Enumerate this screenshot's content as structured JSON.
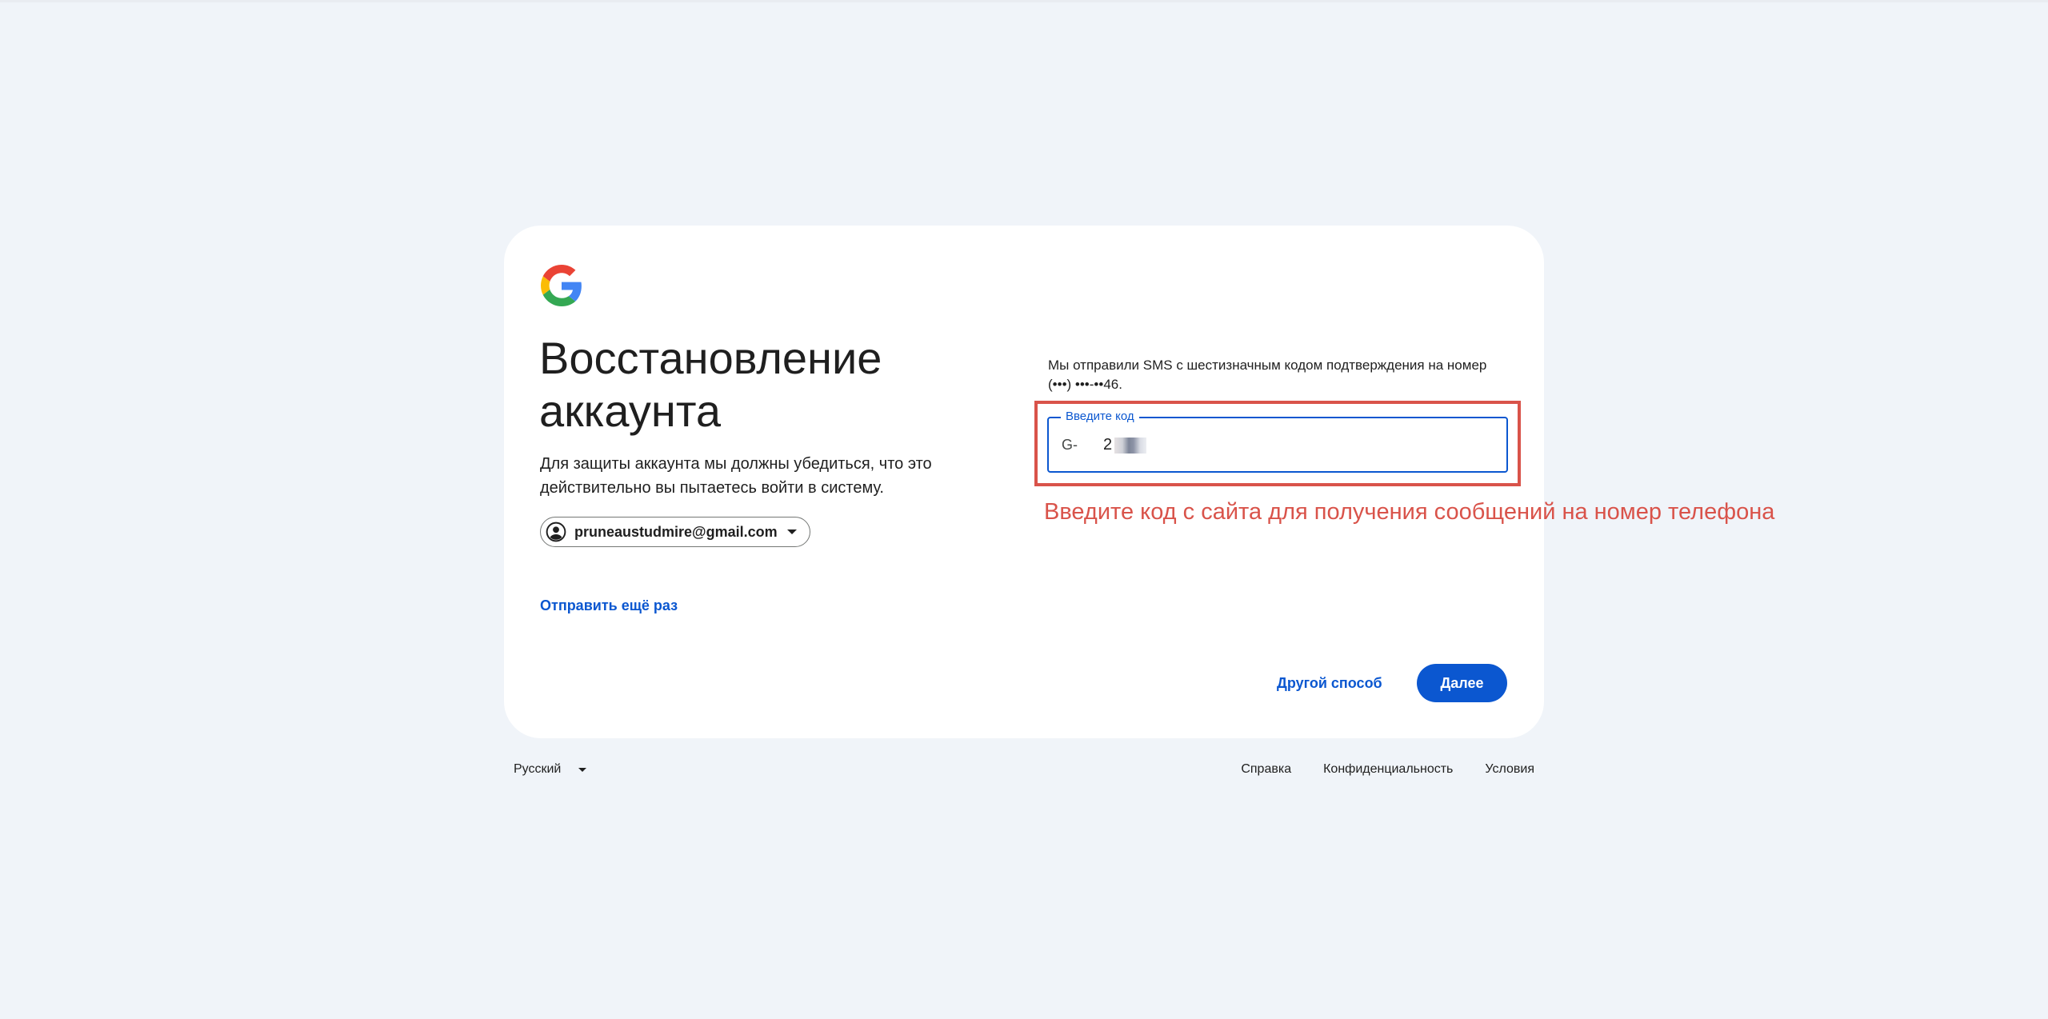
{
  "card": {
    "logo": "google-g-logo",
    "title": "Восстановление аккаунта",
    "subtitle": "Для защиты аккаунта мы должны убедиться, что это действительно вы пытаетесь войти в систему.",
    "account_email": "pruneaustudmire@gmail.com",
    "resend_link": "Отправить ещё раз",
    "sms_message": "Мы отправили SMS с шестизначным кодом подтверждения на номер (•••) •••-••46.",
    "code_field": {
      "label": "Введите код",
      "prefix": "G-",
      "value": "2"
    },
    "other_way_button": "Другой способ",
    "next_button": "Далее"
  },
  "annotation": {
    "text": "Введите код с сайта для получения сообщений на номер телефона",
    "color": "#d9534a"
  },
  "footer": {
    "language": "Русский",
    "links": [
      "Справка",
      "Конфиденциальность",
      "Условия"
    ]
  },
  "colors": {
    "background": "#f0f4f9",
    "accent": "#0b57d0",
    "card": "#ffffff"
  }
}
